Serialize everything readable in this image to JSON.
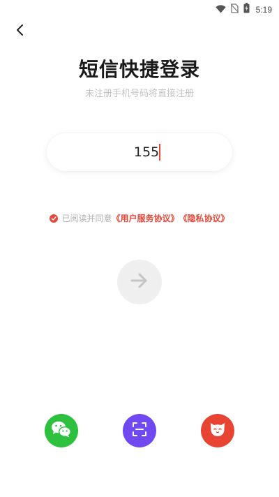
{
  "status_bar": {
    "time": "5:19",
    "icons": [
      "wifi-icon",
      "no-sim-icon",
      "battery-icon"
    ]
  },
  "header": {
    "back_icon": "chevron-left-icon"
  },
  "title": "短信快捷登录",
  "subtitle": "未注册手机号码将直接注册",
  "phone_input": {
    "value": "155"
  },
  "agreement": {
    "checked": true,
    "text": "已阅读并同意",
    "user_agreement": "《用户服务协议》",
    "privacy_policy": "《隐私协议》"
  },
  "submit": {
    "icon": "arrow-right-icon",
    "enabled": false
  },
  "social_logins": [
    {
      "name": "wechat",
      "icon": "wechat-icon",
      "color": "#2dc13f"
    },
    {
      "name": "scan",
      "icon": "scan-icon",
      "color": "#7049f0"
    },
    {
      "name": "mascot",
      "icon": "cat-mascot-icon",
      "color": "#e84434"
    }
  ],
  "colors": {
    "accent": "#e5483a",
    "muted_text": "#b0b0b0",
    "disabled_button": "#efefef"
  }
}
